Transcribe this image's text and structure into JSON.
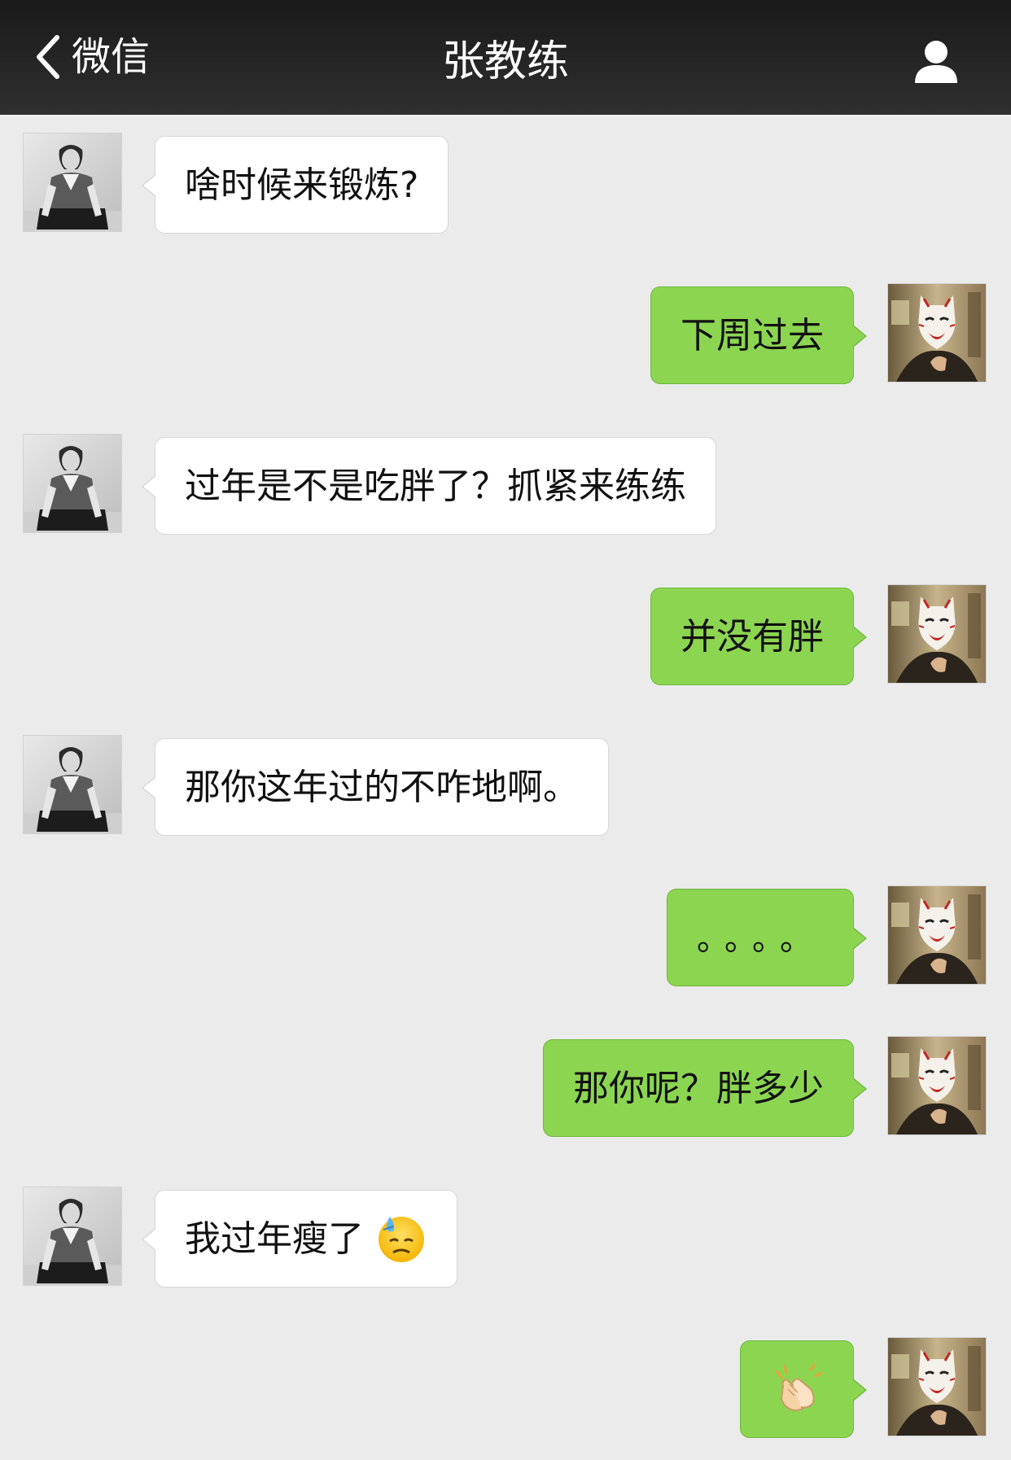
{
  "nav": {
    "back_label": "微信",
    "title": "张教练",
    "profile_icon": "person-icon"
  },
  "messages": [
    {
      "side": "left",
      "sender": "coach",
      "text": "啥时候来锻炼?"
    },
    {
      "side": "right",
      "sender": "me",
      "text": "下周过去"
    },
    {
      "side": "left",
      "sender": "coach",
      "text": "过年是不是吃胖了？抓紧来练练"
    },
    {
      "side": "right",
      "sender": "me",
      "text": "并没有胖"
    },
    {
      "side": "left",
      "sender": "coach",
      "text": "那你这年过的不咋地啊。"
    },
    {
      "side": "right",
      "sender": "me",
      "text": "。。。。"
    },
    {
      "side": "right",
      "sender": "me",
      "text": "那你呢？胖多少"
    },
    {
      "side": "left",
      "sender": "coach",
      "text": "我过年瘦了",
      "emoji": "cold-sweat-face-icon"
    },
    {
      "side": "right",
      "sender": "me",
      "text": "",
      "emoji": "clapping-hands-icon"
    }
  ],
  "colors": {
    "nav_bg": "#222222",
    "chat_bg": "#ebebeb",
    "incoming_bubble": "#ffffff",
    "outgoing_bubble": "#8cd551"
  }
}
